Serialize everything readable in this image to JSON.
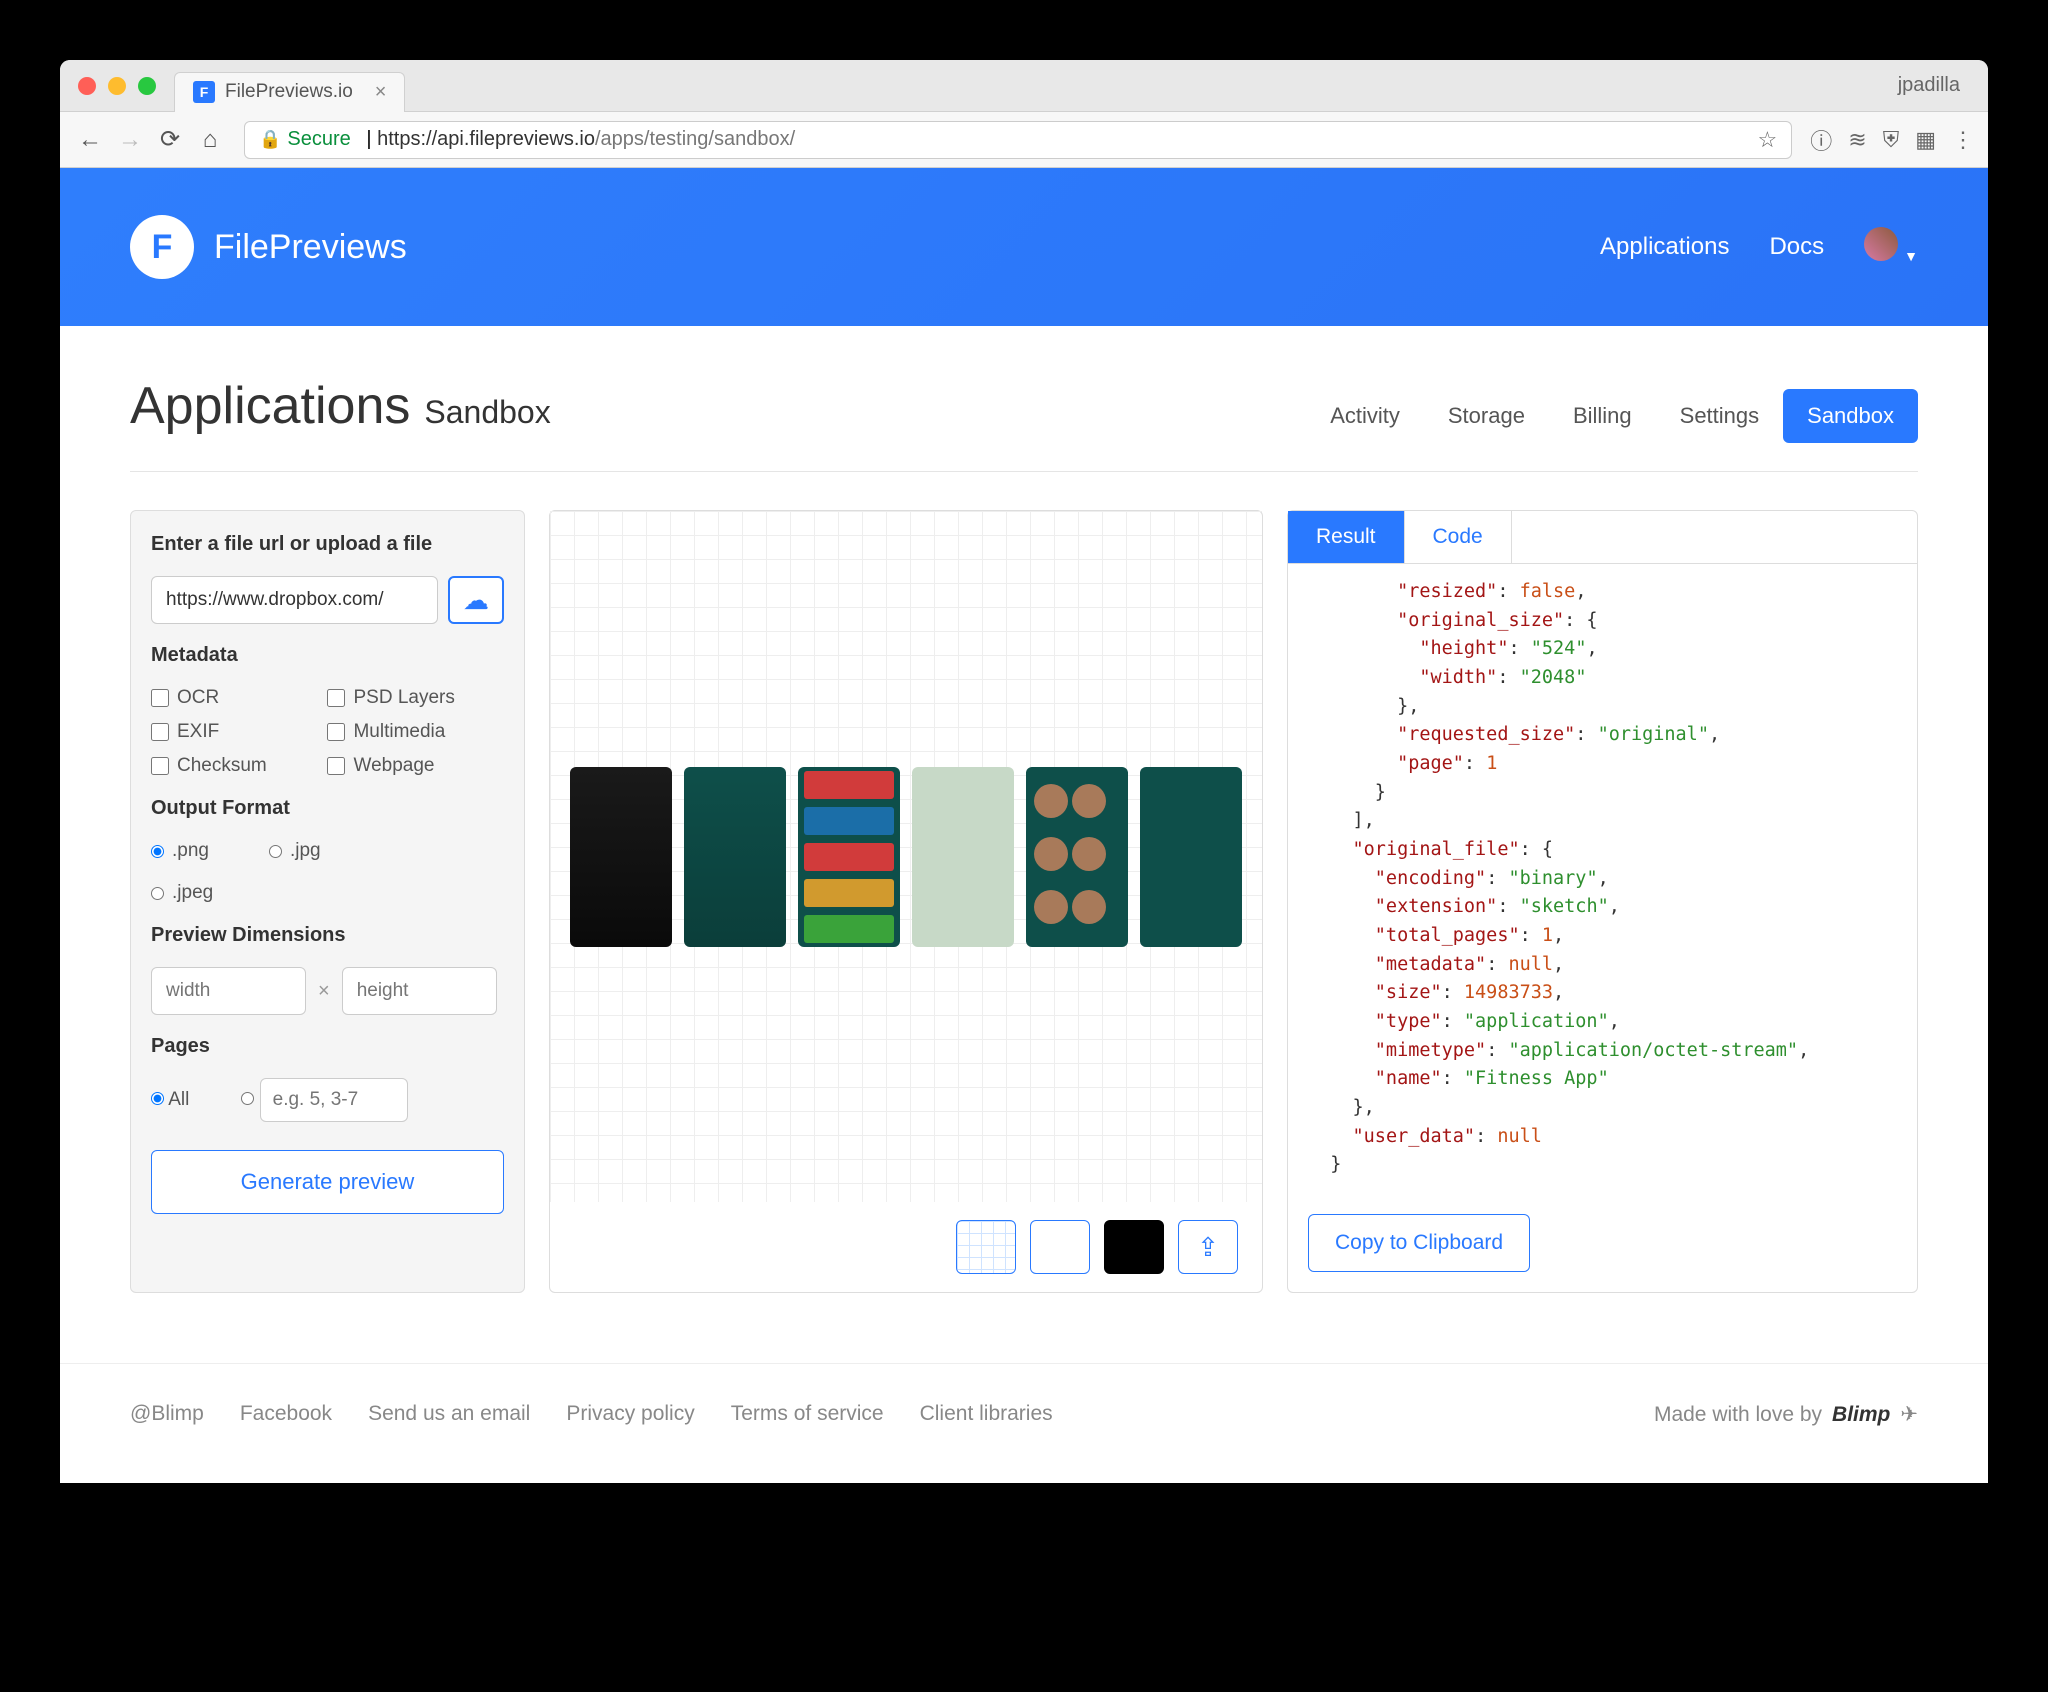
{
  "browser": {
    "tab_title": "FilePreviews.io",
    "profile": "jpadilla",
    "url_secure_label": "Secure",
    "url_domain": "https://api.filepreviews.io",
    "url_path": "/apps/testing/sandbox/"
  },
  "header": {
    "brand": "FilePreviews",
    "nav_applications": "Applications",
    "nav_docs": "Docs"
  },
  "page": {
    "title": "Applications",
    "subtitle": "Sandbox",
    "tabs": {
      "activity": "Activity",
      "storage": "Storage",
      "billing": "Billing",
      "settings": "Settings",
      "sandbox": "Sandbox"
    }
  },
  "left": {
    "enter_label": "Enter a file url or upload a file",
    "url_value": "https://www.dropbox.com/",
    "metadata_label": "Metadata",
    "meta": {
      "ocr": "OCR",
      "psd": "PSD Layers",
      "exif": "EXIF",
      "multimedia": "Multimedia",
      "checksum": "Checksum",
      "webpage": "Webpage"
    },
    "output_label": "Output Format",
    "fmt": {
      "png": ".png",
      "jpg": ".jpg",
      "jpeg": ".jpeg"
    },
    "dims_label": "Preview Dimensions",
    "width_ph": "width",
    "height_ph": "height",
    "pages_label": "Pages",
    "pages_all": "All",
    "pages_ph": "e.g. 5, 3-7",
    "generate": "Generate preview"
  },
  "right": {
    "tab_result": "Result",
    "tab_code": "Code",
    "copy": "Copy to Clipboard",
    "json": {
      "resized": "false",
      "height": "524",
      "width": "2048",
      "requested_size": "original",
      "page": "1",
      "encoding": "binary",
      "extension": "sketch",
      "total_pages": "1",
      "size": "14983733",
      "type": "application",
      "mimetype": "application/octet-stream",
      "name": "Fitness App",
      "user_data": "null",
      "metadata": "null"
    }
  },
  "footer": {
    "blimp_handle": "@Blimp",
    "facebook": "Facebook",
    "email": "Send us an email",
    "privacy": "Privacy policy",
    "terms": "Terms of service",
    "clients": "Client libraries",
    "made": "Made with love by",
    "blimp": "Blimp"
  }
}
